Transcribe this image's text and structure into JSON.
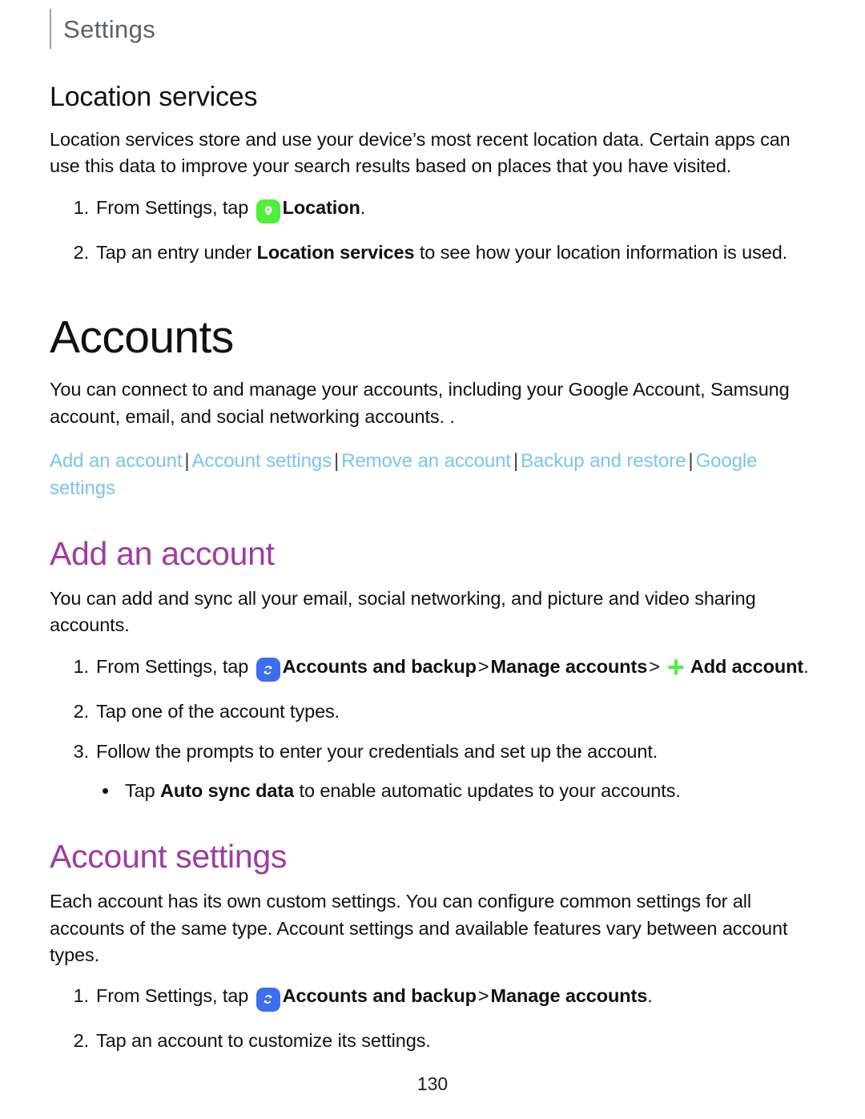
{
  "header": {
    "title": "Settings"
  },
  "location_section": {
    "heading": "Location services",
    "intro": "Location services store and use your device’s most recent location data. Certain apps can use this data to improve your search results based on places that you have visited.",
    "steps": [
      {
        "number": "1.",
        "prefix": "From Settings, tap ",
        "icon": "location-pin-icon",
        "bold_1": "Location",
        "suffix": "."
      },
      {
        "number": "2.",
        "prefix": "Tap an entry under ",
        "bold_1": "Location services",
        "suffix": " to see how your location information is used."
      }
    ]
  },
  "accounts_chapter": {
    "heading": "Accounts",
    "intro": "You can connect to and manage your accounts, including your Google Account, Samsung account, email, and social networking accounts. .",
    "links": [
      "Add an account",
      "Account settings",
      "Remove an account",
      "Backup and restore",
      "Google settings"
    ],
    "link_separator": "|"
  },
  "add_account_section": {
    "heading": "Add an account",
    "intro": "You can add and sync all your email, social networking, and picture and video sharing accounts.",
    "steps": [
      {
        "number": "1.",
        "prefix": "From Settings, tap ",
        "icon": "sync-accounts-icon",
        "bold_1": "Accounts and backup",
        "chevron_1": ">",
        "bold_2": "Manage accounts",
        "chevron_2": ">",
        "icon_2": "plus-icon",
        "bold_3": "Add account",
        "suffix": "."
      },
      {
        "number": "2.",
        "text": "Tap one of the account types."
      },
      {
        "number": "3.",
        "text": "Follow the prompts to enter your credentials and set up the account.",
        "subbullets": [
          {
            "prefix": "Tap ",
            "bold_1": "Auto sync data",
            "suffix": " to enable automatic updates to your accounts."
          }
        ]
      }
    ]
  },
  "account_settings_section": {
    "heading": "Account settings",
    "intro": "Each account has its own custom settings. You can configure common settings for all accounts of the same type. Account settings and available features vary between account types.",
    "steps": [
      {
        "number": "1.",
        "prefix": "From Settings, tap ",
        "icon": "sync-accounts-icon",
        "bold_1": "Accounts and backup",
        "chevron_1": ">",
        "bold_2": "Manage accounts",
        "suffix": "."
      },
      {
        "number": "2.",
        "text": "Tap an account to customize its settings."
      }
    ]
  },
  "footer": {
    "page_number": "130"
  },
  "colors": {
    "link": "#79c5f0",
    "subheading": "#a03ba0",
    "header_text": "#5b6166",
    "location_icon_bg": "#4ef03a",
    "sync_icon_bg": "#3d6df0",
    "plus_icon": "#4ef03a",
    "body_text": "#111111"
  }
}
